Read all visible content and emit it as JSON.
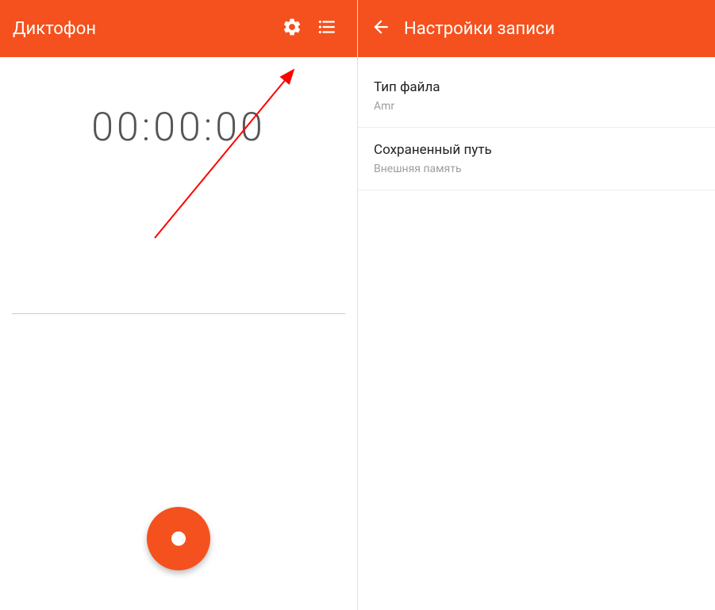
{
  "left": {
    "title": "Диктофон",
    "timer": "00:00:00"
  },
  "right": {
    "title": "Настройки записи",
    "items": [
      {
        "title": "Тип файла",
        "value": "Amr"
      },
      {
        "title": "Сохраненный путь",
        "value": "Внешняя память"
      }
    ]
  },
  "colors": {
    "accent": "#f4511e"
  }
}
